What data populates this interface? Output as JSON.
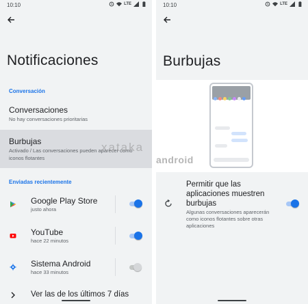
{
  "left": {
    "status": {
      "time": "10:10",
      "network": "LTE"
    },
    "title": "Notificaciones",
    "section_conversacion": "Conversación",
    "conversaciones": {
      "title": "Conversaciones",
      "subtitle": "No hay conversaciones prioritarias"
    },
    "burbujas": {
      "title": "Burbujas",
      "subtitle": "Activado / Las conversaciones pueden aparecer como iconos flotantes"
    },
    "section_recientes": "Enviadas recientemente",
    "apps": [
      {
        "name": "Google Play Store",
        "time": "justo ahora",
        "icon": "play-store-icon",
        "enabled": true
      },
      {
        "name": "YouTube",
        "time": "hace 22 minutos",
        "icon": "youtube-icon",
        "enabled": true
      },
      {
        "name": "Sistema Android",
        "time": "hace 33 minutos",
        "icon": "android-system-icon",
        "enabled": false
      }
    ],
    "ver_todas": "Ver las de los últimos 7 días"
  },
  "right": {
    "status": {
      "time": "10:10",
      "network": "LTE"
    },
    "title": "Burbujas",
    "permitir": {
      "title": "Permitir que las aplicaciones muestren burbujas",
      "subtitle": "Algunas conversaciones aparecerán como iconos flotantes sobre otras aplicaciones",
      "enabled": true
    }
  },
  "watermark": {
    "top": "xataka",
    "bottom": "android"
  },
  "colors": {
    "accent": "#1a73e8",
    "background": "#f1f3f4",
    "highlight": "#dadce0"
  }
}
